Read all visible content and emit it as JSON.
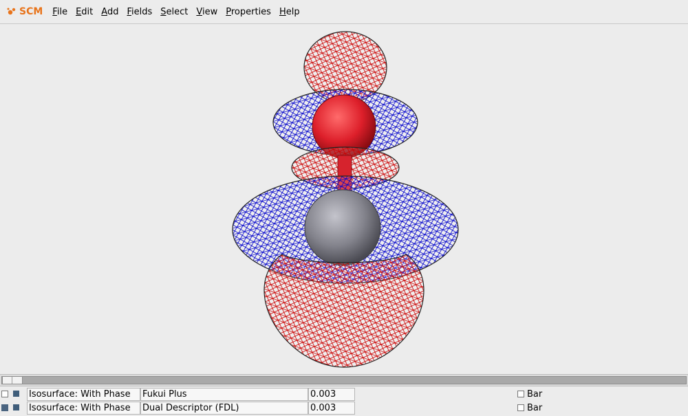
{
  "app": {
    "logo_text": "SCM"
  },
  "menu": [
    {
      "label": "File",
      "accel": "F",
      "rest": "ile"
    },
    {
      "label": "Edit",
      "accel": "E",
      "rest": "dit"
    },
    {
      "label": "Add",
      "accel": "A",
      "rest": "dd"
    },
    {
      "label": "Fields",
      "accel": "F",
      "rest": "ields"
    },
    {
      "label": "Select",
      "accel": "S",
      "rest": "elect"
    },
    {
      "label": "View",
      "accel": "V",
      "rest": "iew"
    },
    {
      "label": "Properties",
      "accel": "P",
      "rest": "roperties"
    },
    {
      "label": "Help",
      "accel": "H",
      "rest": "elp"
    }
  ],
  "fields": [
    {
      "checked": false,
      "type": "Isosurface: With Phase",
      "name": "Fukui Plus",
      "value": "0.003",
      "bar_label": "Bar"
    },
    {
      "checked": true,
      "type": "Isosurface: With Phase",
      "name": "Dual Descriptor (FDL)",
      "value": "0.003",
      "bar_label": "Bar"
    }
  ],
  "colors": {
    "accent": "#e8731a",
    "phase_positive": "#cc0000",
    "phase_negative": "#0000cc"
  },
  "icons": {
    "logo": "scm-logo-icon"
  }
}
